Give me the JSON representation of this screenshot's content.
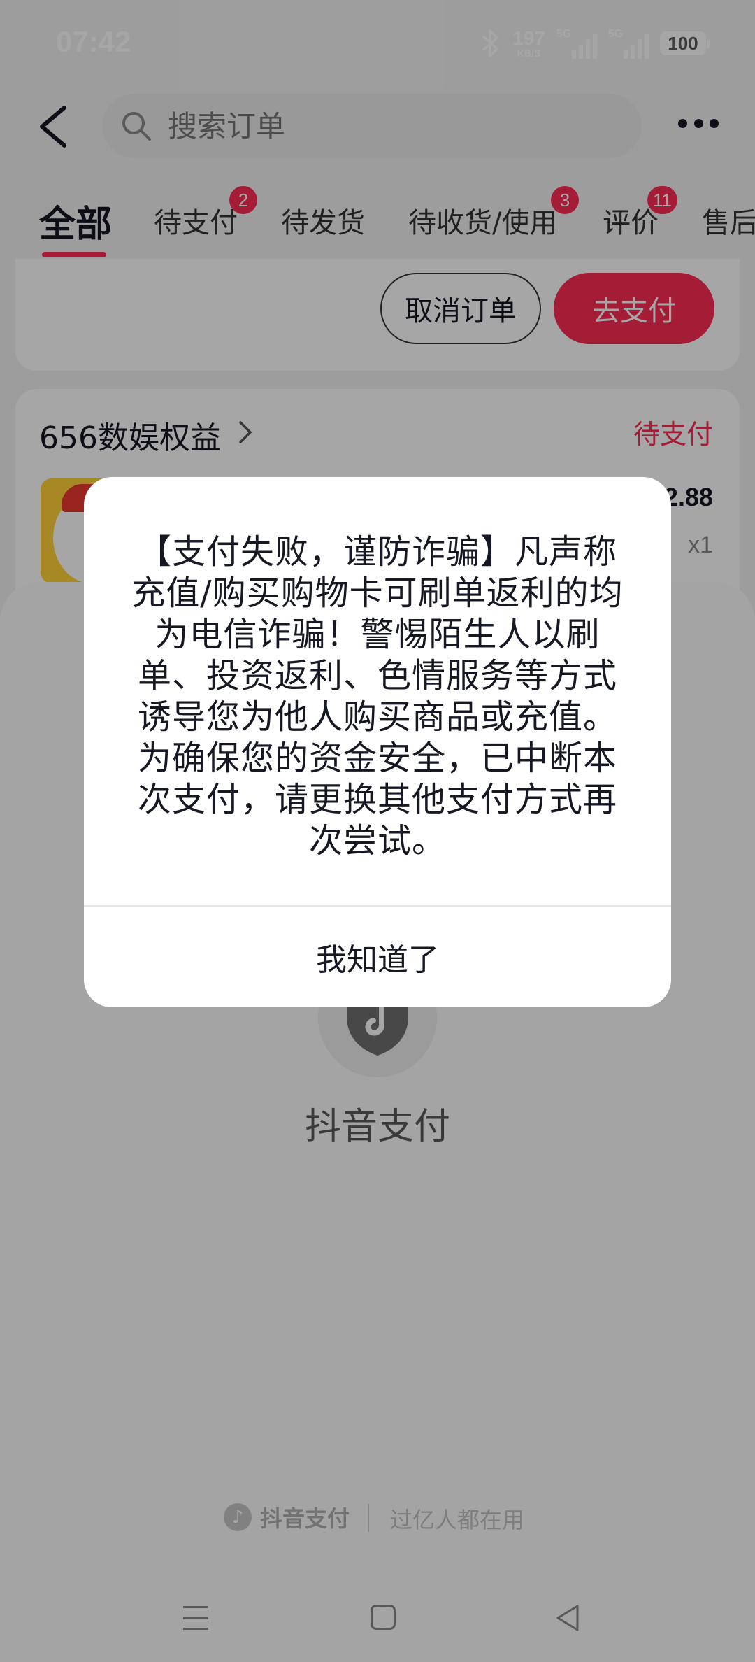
{
  "status_bar": {
    "time": "07:42",
    "net_speed_value": "197",
    "net_speed_unit": "KB/S",
    "sim1_label": "5G",
    "sim2_label": "5G",
    "battery": "100",
    "icons": [
      "bluetooth-icon",
      "signal-icon",
      "signal-icon",
      "battery-icon"
    ]
  },
  "header": {
    "back_icon": "chevron-left-icon",
    "search_placeholder": "搜索订单",
    "search_icon": "search-icon",
    "more_icon": "more-dots-icon"
  },
  "tabs": [
    {
      "label": "全部",
      "active": true,
      "badge": ""
    },
    {
      "label": "待支付",
      "active": false,
      "badge": "2"
    },
    {
      "label": "待发货",
      "active": false,
      "badge": ""
    },
    {
      "label": "待收货/使用",
      "active": false,
      "badge": "3"
    },
    {
      "label": "评价",
      "active": false,
      "badge": "11"
    },
    {
      "label": "售后",
      "active": false,
      "badge": ""
    }
  ],
  "order_actions": {
    "cancel_label": "取消订单",
    "pay_label": "去支付"
  },
  "order": {
    "shop_name": "656数娱权益",
    "status": "待支付",
    "price_partial": "2.88",
    "quantity": "x1"
  },
  "payment_sheet": {
    "title": "抖音支付",
    "footer_brand": "抖音支付",
    "footer_slogan": "过亿人都在用"
  },
  "dialog": {
    "message": "【支付失败，谨防诈骗】凡声称充值/购买购物卡可刷单返利的均为电信诈骗！警惕陌生人以刷单、投资返利、色情服务等方式诱导您为他人购买商品或充值。为确保您的资金安全，已中断本次支付，请更换其他支付方式再次尝试。",
    "button_label": "我知道了"
  },
  "colors": {
    "accent": "#fe2c55",
    "overlay": "rgba(0,0,0,0.35)",
    "text_primary": "#161823"
  }
}
